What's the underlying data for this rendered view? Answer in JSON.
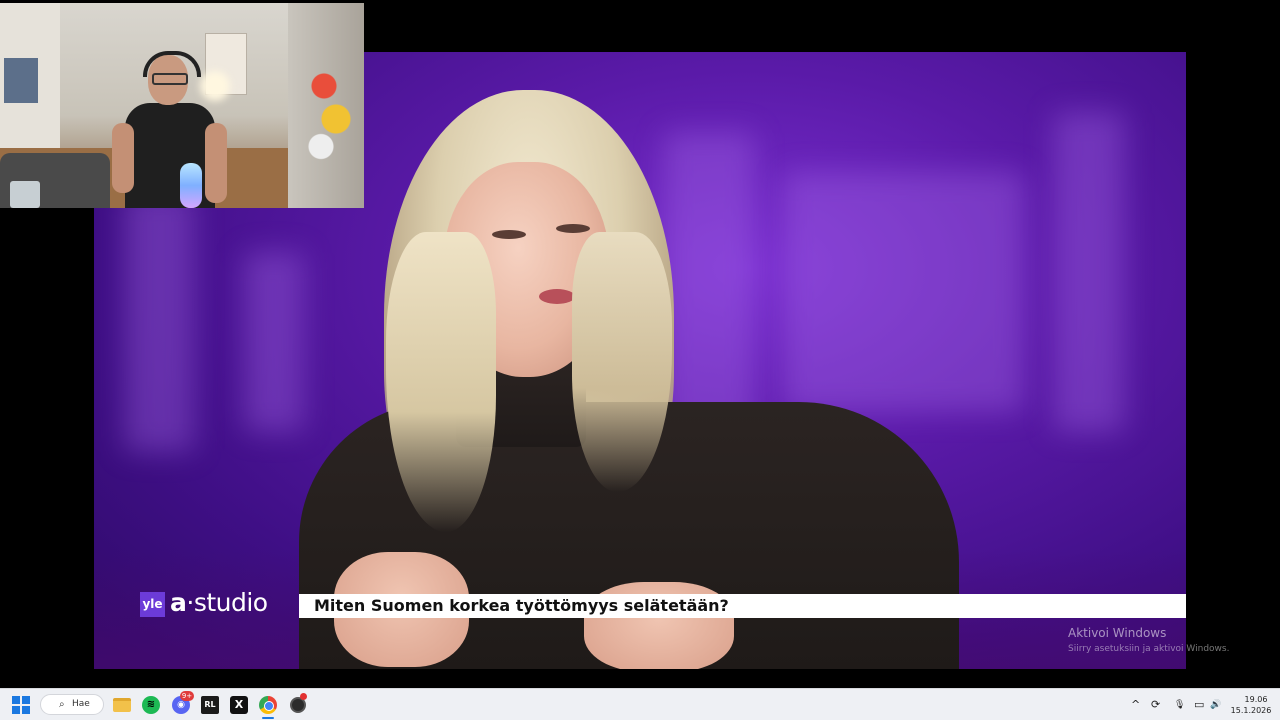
{
  "broadcast": {
    "channel_logo": "yle",
    "show_logo_a": "a",
    "show_logo_rest": "·studio",
    "headline": "Miten Suomen korkea työttömyys selätetään?",
    "accent_color": "#6c3bd8"
  },
  "watermark": {
    "title": "Aktivoi Windows",
    "subtitle": "Siirry asetuksiin ja aktivoi Windows."
  },
  "taskbar": {
    "search_label": "Hae",
    "search_icon": "search-icon",
    "apps": [
      {
        "name": "file-explorer-icon"
      },
      {
        "name": "spotify-icon",
        "glyph": "≋"
      },
      {
        "name": "discord-icon",
        "glyph": "◉",
        "badge": "9+"
      },
      {
        "name": "rl-app-icon",
        "glyph": "RL"
      },
      {
        "name": "x-app-icon",
        "glyph": "X"
      },
      {
        "name": "chrome-icon"
      },
      {
        "name": "obs-icon"
      }
    ],
    "tray": {
      "chevron": "^",
      "sync": "⟳",
      "mic": "🎙",
      "display": "▭",
      "volume": "🔊"
    },
    "clock_time": "19.06",
    "clock_date": "15.1.2026"
  }
}
